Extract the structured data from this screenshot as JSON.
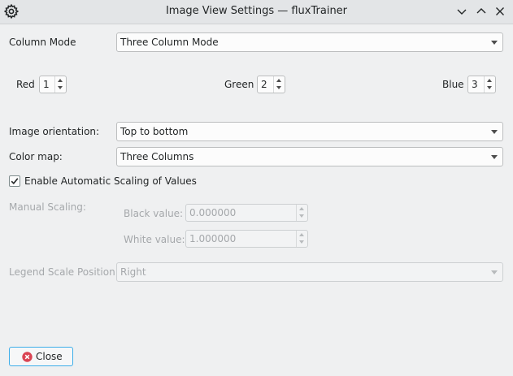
{
  "window": {
    "title": "Image View Settings — fluxTrainer",
    "icons": {
      "app": "gear-icon",
      "minimize": "chevron-down-icon",
      "maximize": "chevron-up-icon",
      "close": "close-icon"
    }
  },
  "column_mode": {
    "label": "Column Mode",
    "value": "Three Column Mode"
  },
  "channels": {
    "red": {
      "label": "Red",
      "value": "1"
    },
    "green": {
      "label": "Green",
      "value": "2"
    },
    "blue": {
      "label": "Blue",
      "value": "3"
    }
  },
  "orientation": {
    "label": "Image orientation:",
    "value": "Top to bottom"
  },
  "color_map": {
    "label": "Color map:",
    "value": "Three Columns"
  },
  "auto_scaling": {
    "label": "Enable Automatic Scaling of Values",
    "checked": true
  },
  "manual_scaling": {
    "label": "Manual Scaling:",
    "black": {
      "label": "Black value:",
      "value": "0.000000"
    },
    "white": {
      "label": "White value:",
      "value": "1.000000"
    }
  },
  "legend": {
    "label": "Legend Scale Position:",
    "value": "Right"
  },
  "close_button": {
    "label": "Close",
    "icon": "close-circle-icon",
    "icon_color": "#da4453"
  },
  "colors": {
    "accent": "#3daee9",
    "background": "#eff0f1",
    "disabled_text": "#a5a8ab"
  }
}
